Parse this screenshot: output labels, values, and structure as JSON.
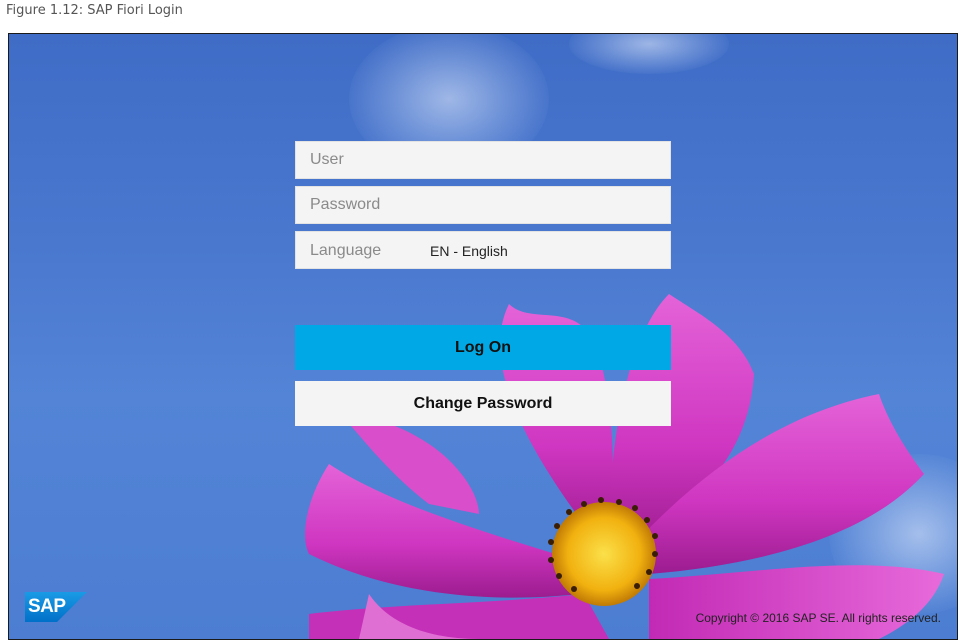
{
  "figure_caption": "Figure 1.12: SAP Fiori Login",
  "login": {
    "user_placeholder": "User",
    "password_placeholder": "Password",
    "language_label": "Language",
    "language_value": "EN - English",
    "logon_label": "Log On",
    "change_password_label": "Change Password"
  },
  "footer": {
    "logo_text": "SAP",
    "copyright": "Copyright © 2016 SAP SE. All rights reserved."
  },
  "colors": {
    "background_blue": "#4a78cf",
    "logon_button": "#00a9e6",
    "field_background": "#f4f4f4",
    "flower_petal": "#d63fc6",
    "flower_center": "#f6c21a"
  }
}
